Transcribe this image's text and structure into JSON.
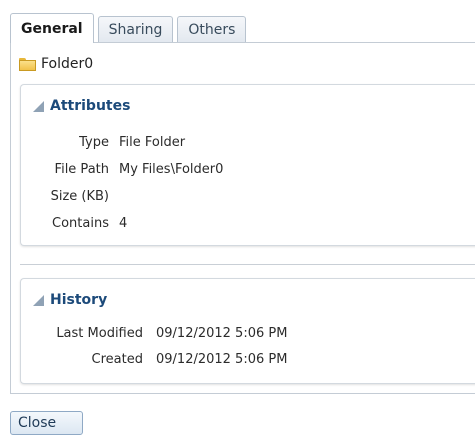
{
  "tabs": [
    {
      "label": "General",
      "active": true
    },
    {
      "label": "Sharing",
      "active": false
    },
    {
      "label": "Others",
      "active": false
    }
  ],
  "folder": {
    "name": "Folder0",
    "icon": "folder-icon"
  },
  "attributes": {
    "title": "Attributes",
    "rows": [
      {
        "label": "Type",
        "value": "File Folder"
      },
      {
        "label": "File Path",
        "value": "My Files\\Folder0"
      },
      {
        "label": "Size (KB)",
        "value": ""
      },
      {
        "label": "Contains",
        "value": "4"
      }
    ]
  },
  "history": {
    "title": "History",
    "rows": [
      {
        "label": "Last Modified",
        "value": "09/12/2012 5:06 PM"
      },
      {
        "label": "Created",
        "value": "09/12/2012 5:06 PM"
      }
    ]
  },
  "buttons": {
    "close_label": "Close"
  },
  "colors": {
    "section_title": "#1c4a7a",
    "tab_border": "#b8c3cf",
    "folder": "#f1c24a"
  }
}
